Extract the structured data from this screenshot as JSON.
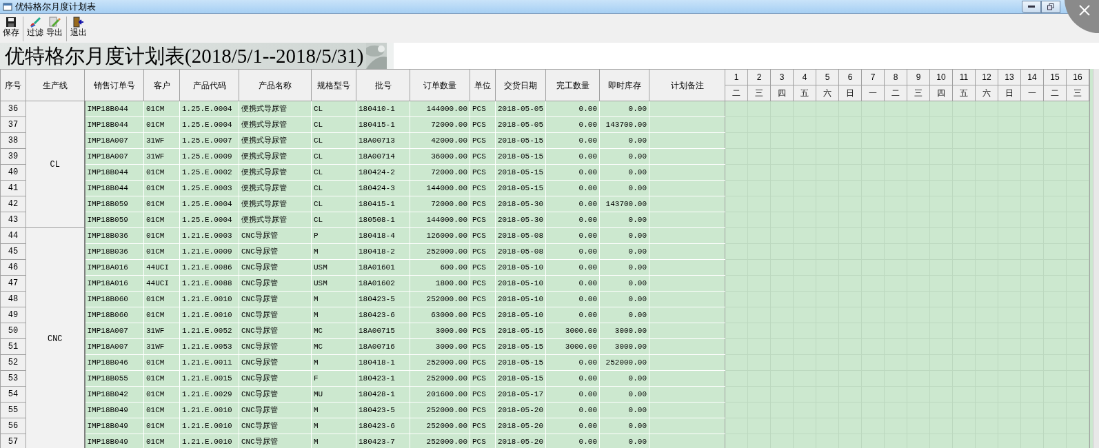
{
  "window": {
    "title": "优特格尔月度计划表"
  },
  "toolbar": {
    "groups": [
      {
        "buttons": [
          {
            "label": "保存",
            "kind": "save"
          }
        ]
      },
      {
        "buttons": [
          {
            "label": "过滤",
            "kind": "filter"
          },
          {
            "label": "导出",
            "kind": "export"
          }
        ]
      },
      {
        "buttons": [
          {
            "label": "退出",
            "kind": "exit"
          }
        ]
      }
    ]
  },
  "banner": {
    "title": "优特格尔月度计划表(2018/5/1--2018/5/31)"
  },
  "table": {
    "columns": [
      "序号",
      "生产线",
      "销售订单号",
      "客户",
      "产品代码",
      "产品名称",
      "规格型号",
      "批号",
      "订单数量",
      "单位",
      "交货日期",
      "完工数量",
      "即时库存",
      "计划备注"
    ],
    "days": [
      {
        "day": "1",
        "weekday": "二"
      },
      {
        "day": "2",
        "weekday": "三"
      },
      {
        "day": "3",
        "weekday": "四"
      },
      {
        "day": "4",
        "weekday": "五"
      },
      {
        "day": "5",
        "weekday": "六"
      },
      {
        "day": "6",
        "weekday": "日"
      },
      {
        "day": "7",
        "weekday": "一"
      },
      {
        "day": "8",
        "weekday": "二"
      },
      {
        "day": "9",
        "weekday": "三"
      },
      {
        "day": "10",
        "weekday": "四"
      },
      {
        "day": "11",
        "weekday": "五"
      },
      {
        "day": "12",
        "weekday": "六"
      },
      {
        "day": "13",
        "weekday": "日"
      },
      {
        "day": "14",
        "weekday": "一"
      },
      {
        "day": "15",
        "weekday": "二"
      },
      {
        "day": "16",
        "weekday": "三"
      }
    ],
    "groups": [
      {
        "line": "CL",
        "rows": [
          [
            "36",
            "IMP18B044",
            "01CM",
            "1.25.E.0004",
            "便携式导尿管",
            "CL",
            "180410-1",
            "144000.00",
            "PCS",
            "2018-05-05",
            "0.00",
            "0.00"
          ],
          [
            "37",
            "IMP18B044",
            "01CM",
            "1.25.E.0004",
            "便携式导尿管",
            "CL",
            "180415-1",
            "72000.00",
            "PCS",
            "2018-05-05",
            "0.00",
            "143700.00"
          ],
          [
            "38",
            "IMP18A007",
            "31WF",
            "1.25.E.0007",
            "便携式导尿管",
            "CL",
            "18A00713",
            "42000.00",
            "PCS",
            "2018-05-15",
            "0.00",
            "0.00"
          ],
          [
            "39",
            "IMP18A007",
            "31WF",
            "1.25.E.0009",
            "便携式导尿管",
            "CL",
            "18A00714",
            "36000.00",
            "PCS",
            "2018-05-15",
            "0.00",
            "0.00"
          ],
          [
            "40",
            "IMP18B044",
            "01CM",
            "1.25.E.0002",
            "便携式导尿管",
            "CL",
            "180424-2",
            "72000.00",
            "PCS",
            "2018-05-15",
            "0.00",
            "0.00"
          ],
          [
            "41",
            "IMP18B044",
            "01CM",
            "1.25.E.0003",
            "便携式导尿管",
            "CL",
            "180424-3",
            "144000.00",
            "PCS",
            "2018-05-15",
            "0.00",
            "0.00"
          ],
          [
            "42",
            "IMP18B059",
            "01CM",
            "1.25.E.0004",
            "便携式导尿管",
            "CL",
            "180415-1",
            "72000.00",
            "PCS",
            "2018-05-30",
            "0.00",
            "143700.00"
          ],
          [
            "43",
            "IMP18B059",
            "01CM",
            "1.25.E.0004",
            "便携式导尿管",
            "CL",
            "180508-1",
            "144000.00",
            "PCS",
            "2018-05-30",
            "0.00",
            "0.00"
          ]
        ]
      },
      {
        "line": "CNC",
        "rows": [
          [
            "44",
            "IMP18B036",
            "01CM",
            "1.21.E.0003",
            "CNC导尿管",
            "P",
            "180418-4",
            "126000.00",
            "PCS",
            "2018-05-08",
            "0.00",
            "0.00"
          ],
          [
            "45",
            "IMP18B036",
            "01CM",
            "1.21.E.0009",
            "CNC导尿管",
            "M",
            "180418-2",
            "252000.00",
            "PCS",
            "2018-05-08",
            "0.00",
            "0.00"
          ],
          [
            "46",
            "IMP18A016",
            "44UCI",
            "1.21.E.0086",
            "CNC导尿管",
            "USM",
            "18A01601",
            "600.00",
            "PCS",
            "2018-05-10",
            "0.00",
            "0.00"
          ],
          [
            "47",
            "IMP18A016",
            "44UCI",
            "1.21.E.0088",
            "CNC导尿管",
            "USM",
            "18A01602",
            "1800.00",
            "PCS",
            "2018-05-10",
            "0.00",
            "0.00"
          ],
          [
            "48",
            "IMP18B060",
            "01CM",
            "1.21.E.0010",
            "CNC导尿管",
            "M",
            "180423-5",
            "252000.00",
            "PCS",
            "2018-05-10",
            "0.00",
            "0.00"
          ],
          [
            "49",
            "IMP18B060",
            "01CM",
            "1.21.E.0010",
            "CNC导尿管",
            "M",
            "180423-6",
            "63000.00",
            "PCS",
            "2018-05-10",
            "0.00",
            "0.00"
          ],
          [
            "50",
            "IMP18A007",
            "31WF",
            "1.21.E.0052",
            "CNC导尿管",
            "MC",
            "18A00715",
            "3000.00",
            "PCS",
            "2018-05-15",
            "3000.00",
            "3000.00"
          ],
          [
            "51",
            "IMP18A007",
            "31WF",
            "1.21.E.0053",
            "CNC导尿管",
            "MC",
            "18A00716",
            "3000.00",
            "PCS",
            "2018-05-15",
            "3000.00",
            "3000.00"
          ],
          [
            "52",
            "IMP18B046",
            "01CM",
            "1.21.E.0011",
            "CNC导尿管",
            "M",
            "180418-1",
            "252000.00",
            "PCS",
            "2018-05-15",
            "0.00",
            "252000.00"
          ],
          [
            "53",
            "IMP18B055",
            "01CM",
            "1.21.E.0015",
            "CNC导尿管",
            "F",
            "180423-1",
            "252000.00",
            "PCS",
            "2018-05-15",
            "0.00",
            "0.00"
          ],
          [
            "54",
            "IMP18B042",
            "01CM",
            "1.21.E.0029",
            "CNC导尿管",
            "MU",
            "180428-1",
            "201600.00",
            "PCS",
            "2018-05-17",
            "0.00",
            "0.00"
          ],
          [
            "55",
            "IMP18B049",
            "01CM",
            "1.21.E.0010",
            "CNC导尿管",
            "M",
            "180423-5",
            "252000.00",
            "PCS",
            "2018-05-20",
            "0.00",
            "0.00"
          ],
          [
            "56",
            "IMP18B049",
            "01CM",
            "1.21.E.0010",
            "CNC导尿管",
            "M",
            "180423-6",
            "252000.00",
            "PCS",
            "2018-05-20",
            "0.00",
            "0.00"
          ],
          [
            "57",
            "IMP18B049",
            "01CM",
            "1.21.E.0010",
            "CNC导尿管",
            "M",
            "180423-7",
            "252000.00",
            "PCS",
            "2018-05-20",
            "0.00",
            "0.00"
          ]
        ]
      }
    ]
  }
}
